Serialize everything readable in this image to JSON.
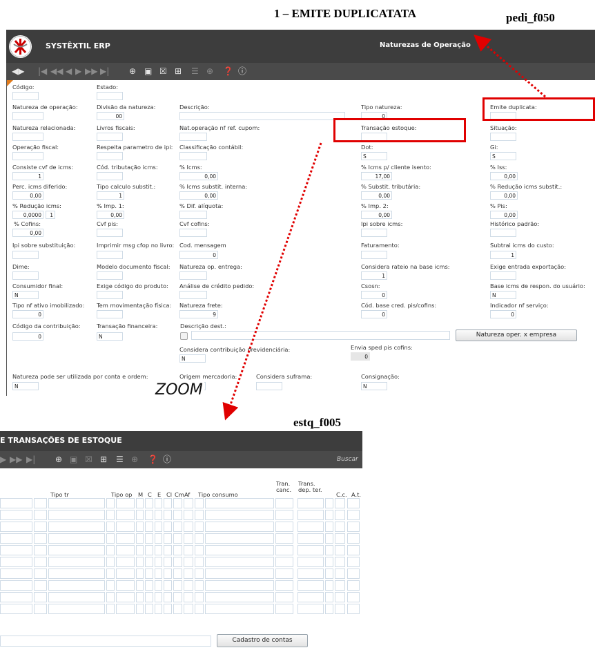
{
  "annotations": {
    "emite_title": "1 – EMITE DUPLICATATA",
    "pedi_code": "pedi_f050",
    "estq_code": "estq_f005",
    "zoom": "ZOOM",
    "arrow_color": "#e00000"
  },
  "app": {
    "name": "SYSTÊXTIL ERP",
    "screen_title": "Naturezas de Operação",
    "logo": "systextil-logo-icon"
  },
  "toolbar": {
    "icons": [
      "nav-toggle-icon",
      "first-record-icon",
      "prev-page-icon",
      "prev-record-icon",
      "next-record-icon",
      "next-page-icon",
      "last-record-icon",
      "new-record-icon",
      "save-icon",
      "delete-icon",
      "copy-icon",
      "list-icon",
      "zoom-icon",
      "help-icon",
      "info-icon"
    ]
  },
  "form": {
    "codigo": {
      "label": "Código:",
      "value": ""
    },
    "estado": {
      "label": "Estado:",
      "value": ""
    },
    "natureza_operacao": {
      "label": "Natureza de operação:",
      "value": ""
    },
    "divisao_natureza": {
      "label": "Divisão da natureza:",
      "value": "00"
    },
    "descricao": {
      "label": "Descrição:",
      "value": ""
    },
    "tipo_natureza": {
      "label": "Tipo natureza:",
      "value": "0"
    },
    "emite_duplicata": {
      "label": "Emite duplicata:",
      "value": ""
    },
    "natureza_relacionada": {
      "label": "Natureza relacionada:",
      "value": ""
    },
    "livros_fiscais": {
      "label": "Livros fiscais:",
      "value": ""
    },
    "nat_operacao_nf_ref_cupom": {
      "label": "Nat.operação nf ref. cupom:",
      "value": ""
    },
    "transacao_estoque": {
      "label": "Transação estoque:",
      "value": ""
    },
    "situacao": {
      "label": "Situação:",
      "value": ""
    },
    "operacao_fiscal": {
      "label": "Operação fiscal:",
      "value": ""
    },
    "respeita_parametro_ipi": {
      "label": "Respeita parametro de ipi:",
      "value": ""
    },
    "classificacao_contabil": {
      "label": "Classificação contábil:",
      "value": ""
    },
    "dot": {
      "label": "Dot:",
      "value": "S"
    },
    "gi": {
      "label": "Gi:",
      "value": "S"
    },
    "consiste_cvf_icms": {
      "label": "Consiste cvf de icms:",
      "value": "1"
    },
    "cod_tributacao_icms": {
      "label": "Cód. tributação icms:",
      "value": ""
    },
    "pct_icms": {
      "label": "% Icms:",
      "value": "0,00"
    },
    "pct_icms_cliente_isento": {
      "label": "% Icms p/ cliente isento:",
      "value": "17,00"
    },
    "pct_iss": {
      "label": "% Iss:",
      "value": "0,00"
    },
    "perc_icms_diferido": {
      "label": "Perc. icms diferido:",
      "value": "0,00"
    },
    "tipo_calculo_substit": {
      "label": "Tipo calculo substit.:",
      "value": "1"
    },
    "pct_icms_substit_interna": {
      "label": "% Icms substit. interna:",
      "value": "0,00"
    },
    "pct_substit_tributaria": {
      "label": "% Substit. tributária:",
      "value": "0,00"
    },
    "pct_reducao_icms_substit": {
      "label": "% Redução icms substit.:",
      "value": "0,00"
    },
    "pct_reducao_icms": {
      "label": "% Redução icms:",
      "value": "0,0000",
      "extra": "1"
    },
    "pct_imp_1": {
      "label": "% Imp. 1:",
      "value": "0,00"
    },
    "pct_dif_aliquota": {
      "label": "% Dif. alíquota:",
      "value": ""
    },
    "pct_imp_2": {
      "label": "% Imp. 2:",
      "value": "0,00"
    },
    "pct_pis": {
      "label": "% Pis:",
      "value": "0,00"
    },
    "pct_cofins": {
      "label": "% Cofins:",
      "value": "0,00"
    },
    "cvf_pis": {
      "label": "Cvf pis:",
      "value": ""
    },
    "cvf_cofins": {
      "label": "Cvf cofins:",
      "value": ""
    },
    "ipi_sobre_icms": {
      "label": "Ipi sobre icms:",
      "value": ""
    },
    "historico_padrao": {
      "label": "Histórico padrão:",
      "value": ""
    },
    "ipi_sobre_substituicao": {
      "label": "Ipi sobre substituição:",
      "value": ""
    },
    "imprimir_msg_cfop": {
      "label": "Imprimir msg cfop no livro:",
      "value": ""
    },
    "cod_mensagem": {
      "label": "Cod. mensagem",
      "value": "0"
    },
    "faturamento": {
      "label": "Faturamento:",
      "value": ""
    },
    "subtrai_icms_custo": {
      "label": "Subtrai icms do custo:",
      "value": "1"
    },
    "dime": {
      "label": "Dime:",
      "value": ""
    },
    "modelo_documento_fiscal": {
      "label": "Modelo documento fiscal:",
      "value": ""
    },
    "natureza_op_entrega": {
      "label": "Natureza op. entrega:",
      "value": ""
    },
    "considera_rateio": {
      "label": "Considera rateio na base icms:",
      "value": "1"
    },
    "exige_entrada_exportacao": {
      "label": "Exige entrada exportação:",
      "value": ""
    },
    "consumidor_final": {
      "label": "Consumidor final:",
      "value": "N"
    },
    "exige_codigo_produto": {
      "label": "Exige código do produto:",
      "value": ""
    },
    "analise_credito": {
      "label": "Análise de crédito pedido:",
      "value": ""
    },
    "csosn": {
      "label": "Csosn:",
      "value": "0"
    },
    "base_icms_respon": {
      "label": "Base icms de respon. do usuário:",
      "value": "N"
    },
    "tipo_nf_ativo": {
      "label": "Tipo nf ativo imobilizado:",
      "value": "0"
    },
    "tem_movimentacao_fisica": {
      "label": "Tem movimentação física:",
      "value": ""
    },
    "natureza_frete": {
      "label": "Natureza frete:",
      "value": "9"
    },
    "cod_base_cred": {
      "label": "Cód. base cred. pis/cofins:",
      "value": "0"
    },
    "indicador_nf_servico": {
      "label": "Indicador nf serviço:",
      "value": "0"
    },
    "codigo_contribuicao": {
      "label": "Código da contribuição:",
      "value": "0"
    },
    "transacao_financeira": {
      "label": "Transação financeira:",
      "value": "N"
    },
    "descricao_dest": {
      "label": "Descrição dest.:",
      "value": ""
    },
    "natureza_oper_empresa_button": "Natureza oper. x empresa",
    "considera_contribuicao": {
      "label": "Considera contribuição previdenciária:",
      "value": "N"
    },
    "envia_sped": {
      "label": "Envia sped pis cofins:",
      "value": "0"
    },
    "natureza_conta_ordem": {
      "label": "Natureza pode ser utilizada por conta e ordem:",
      "value": "N"
    },
    "origem_mercadoria": {
      "label": "Origem mercadoria:",
      "value": ""
    },
    "considera_suframa": {
      "label": "Considera suframa:",
      "value": ""
    },
    "consignacao": {
      "label": "Consignação:",
      "value": "N"
    }
  },
  "estq": {
    "title": "E TRANSAÇÕES DE ESTOQUE",
    "buscar": "Buscar",
    "columns": {
      "tipo_tr": "Tipo tr",
      "tipo_op": "Tipo op",
      "m": "M",
      "c": "C",
      "e": "E",
      "cl": "Cl",
      "cm": "Cm",
      "af": "Af",
      "tipo_consumo": "Tipo consumo",
      "tran_canc_1": "Tran.",
      "tran_canc_2": "canc.",
      "trans_dep_1": "Trans.",
      "trans_dep_2": "dep. ter.",
      "cc": "C.c.",
      "at": "A.t."
    },
    "cadastro_button": "Cadastro de contas"
  }
}
